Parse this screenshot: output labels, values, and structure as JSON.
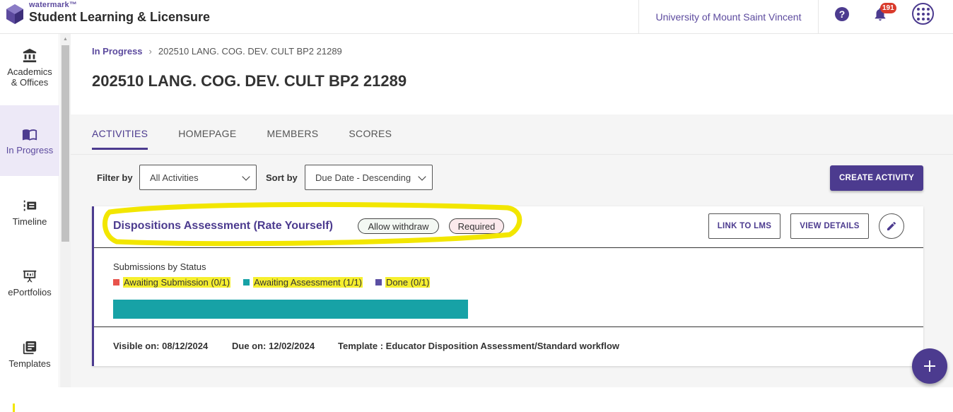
{
  "header": {
    "brand_small": "watermark™",
    "brand_title": "Student Learning & Licensure",
    "institution": "University of Mount Saint Vincent",
    "help_icon": "?",
    "notification_count": "191"
  },
  "sidebar": {
    "items": [
      {
        "label_line1": "Academics",
        "label_line2": "& Offices",
        "icon": "bank-icon"
      },
      {
        "label": "In Progress",
        "icon": "open-book-icon"
      },
      {
        "label": "Timeline",
        "icon": "timeline-icon"
      },
      {
        "label": "ePortfolios",
        "icon": "presentation-icon"
      },
      {
        "label": "Templates",
        "icon": "templates-icon"
      }
    ]
  },
  "breadcrumb": {
    "parent": "In Progress",
    "separator": "›",
    "current": "202510 LANG. COG. DEV. CULT BP2 21289"
  },
  "page_title": "202510 LANG. COG. DEV. CULT BP2 21289",
  "tabs": [
    "ACTIVITIES",
    "HOMEPAGE",
    "MEMBERS",
    "SCORES"
  ],
  "filters": {
    "filter_label": "Filter by",
    "filter_value": "All Activities",
    "sort_label": "Sort by",
    "sort_value": "Due Date - Descending",
    "create_label": "CREATE ACTIVITY"
  },
  "activity": {
    "title": "Dispositions Assessment (Rate Yourself)",
    "pill_withdraw": "Allow withdraw",
    "pill_required": "Required",
    "link_lms": "LINK TO LMS",
    "view_details": "VIEW DETAILS",
    "submissions_title": "Submissions by Status",
    "legend": [
      {
        "label": "Awaiting Submission (0/1)",
        "color": "#e8534c"
      },
      {
        "label": "Awaiting Assessment (1/1)",
        "color": "#17a2a6"
      },
      {
        "label": "Done (0/1)",
        "color": "#5b4fa3"
      }
    ],
    "status_fractions": {
      "awaiting_submission": 0,
      "awaiting_assessment": 1,
      "done": 0
    },
    "visible_on": "Visible on: 08/12/2024",
    "due_on": "Due on: 12/02/2024",
    "template": "Template : Educator Disposition Assessment/Standard workflow"
  },
  "colors": {
    "accent": "#4c3b8f",
    "highlight": "#f2e600"
  }
}
